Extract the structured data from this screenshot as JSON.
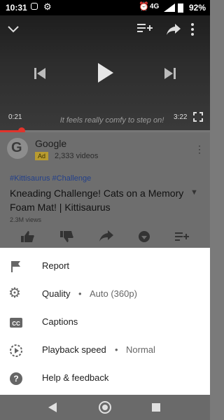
{
  "status": {
    "time": "10:31",
    "network": "4G",
    "battery": "92%"
  },
  "player": {
    "subtitle": "It feels really comfy to step on!",
    "current_time": "0:21",
    "duration": "3:22",
    "progress": 0.104
  },
  "channel": {
    "name": "Google",
    "ad_badge": "Ad",
    "video_count": "2,333 videos"
  },
  "video": {
    "hashtags": "#Kittisaurus #Challenge",
    "title": "Kneading Challenge! Cats on a Memory Foam Mat! | Kittisaurus",
    "views": "2.3M views"
  },
  "menu": {
    "report": "Report",
    "quality": "Quality",
    "quality_value": "Auto (360p)",
    "captions": "Captions",
    "playback_speed": "Playback speed",
    "playback_speed_value": "Normal",
    "help": "Help & feedback",
    "separator": "•"
  },
  "colors": {
    "accent": "#e0342c",
    "ad_badge": "#b89b30",
    "hashtag": "#23408a"
  },
  "icons": [
    "flag-icon",
    "gear-icon",
    "cc-icon",
    "playback-speed-icon",
    "help-icon",
    "chevron-down-icon",
    "add-to-playlist-icon",
    "share-icon",
    "previous-icon",
    "play-icon",
    "next-icon",
    "fullscreen-icon",
    "like-icon",
    "dislike-icon",
    "download-icon",
    "back-icon",
    "home-icon",
    "recents-icon"
  ]
}
